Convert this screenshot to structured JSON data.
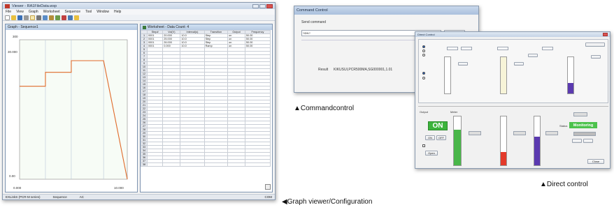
{
  "graph_app": {
    "title": "Viewer - RA1FileData.wsp",
    "menu": [
      "File",
      "View",
      "Graph",
      "Worksheet",
      "Sequence",
      "Tool",
      "Window",
      "Help"
    ],
    "graph": {
      "title": "Graph - Sequence1",
      "y_top": "300",
      "y_mid": "30.000",
      "y_bottom": "0.00",
      "x_left": "0.000",
      "x_right": "10.000",
      "chart_data": {
        "type": "line",
        "series": [
          {
            "x": [
              0,
              2.4,
              2.4,
              4.8,
              4.8,
              7.8,
              10
            ],
            "y": [
              200,
              200,
              230,
              230,
              255,
              255,
              0
            ]
          }
        ],
        "xlim": [
          0,
          10
        ],
        "ylim": [
          0,
          300
        ]
      }
    },
    "worksheet": {
      "title": "Worksheet - Data Count: 4",
      "headers": [
        "",
        "Step#",
        "Vol(V)",
        "Interval(s)",
        "Transition",
        "Output",
        "Frequency"
      ],
      "rows": [
        [
          "1",
          "0001",
          "20.000",
          "10.0",
          "Step",
          "on",
          "50.00"
        ],
        [
          "2",
          "0001",
          "25.000",
          "10.0",
          "Step",
          "on",
          "50.00"
        ],
        [
          "3",
          "0001",
          "26.000",
          "10.0",
          "Step",
          "on",
          "50.00"
        ],
        [
          "4",
          "0001",
          "0.000",
          "10.0",
          "Ramp",
          "on",
          "50.00"
        ],
        [
          "5",
          "",
          "",
          "",
          "",
          "",
          ""
        ],
        [
          "6",
          "",
          "",
          "",
          "",
          "",
          ""
        ],
        [
          "7",
          "",
          "",
          "",
          "",
          "",
          ""
        ],
        [
          "8",
          "",
          "",
          "",
          "",
          "",
          ""
        ],
        [
          "9",
          "",
          "",
          "",
          "",
          "",
          ""
        ],
        [
          "10",
          "",
          "",
          "",
          "",
          "",
          ""
        ],
        [
          "11",
          "",
          "",
          "",
          "",
          "",
          ""
        ],
        [
          "12",
          "",
          "",
          "",
          "",
          "",
          ""
        ],
        [
          "13",
          "",
          "",
          "",
          "",
          "",
          ""
        ],
        [
          "14",
          "",
          "",
          "",
          "",
          "",
          ""
        ],
        [
          "15",
          "",
          "",
          "",
          "",
          "",
          ""
        ],
        [
          "16",
          "",
          "",
          "",
          "",
          "",
          ""
        ],
        [
          "17",
          "",
          "",
          "",
          "",
          "",
          ""
        ],
        [
          "18",
          "",
          "",
          "",
          "",
          "",
          ""
        ],
        [
          "19",
          "",
          "",
          "",
          "",
          "",
          ""
        ],
        [
          "20",
          "",
          "",
          "",
          "",
          "",
          ""
        ],
        [
          "21",
          "",
          "",
          "",
          "",
          "",
          ""
        ],
        [
          "22",
          "",
          "",
          "",
          "",
          "",
          ""
        ],
        [
          "23",
          "",
          "",
          "",
          "",
          "",
          ""
        ],
        [
          "24",
          "",
          "",
          "",
          "",
          "",
          ""
        ],
        [
          "25",
          "",
          "",
          "",
          "",
          "",
          ""
        ],
        [
          "26",
          "",
          "",
          "",
          "",
          "",
          ""
        ],
        [
          "27",
          "",
          "",
          "",
          "",
          "",
          ""
        ],
        [
          "28",
          "",
          "",
          "",
          "",
          "",
          ""
        ],
        [
          "29",
          "",
          "",
          "",
          "",
          "",
          ""
        ],
        [
          "30",
          "",
          "",
          "",
          "",
          "",
          ""
        ],
        [
          "31",
          "",
          "",
          "",
          "",
          "",
          ""
        ],
        [
          "32",
          "",
          "",
          "",
          "",
          "",
          ""
        ],
        [
          "33",
          "",
          "",
          "",
          "",
          "",
          ""
        ],
        [
          "34",
          "",
          "",
          "",
          "",
          "",
          ""
        ],
        [
          "35",
          "",
          "",
          "",
          "",
          "",
          ""
        ],
        [
          "36",
          "",
          "",
          "",
          "",
          "",
          ""
        ],
        [
          "37",
          "",
          "",
          "",
          "",
          "",
          ""
        ],
        [
          "38",
          "",
          "",
          "",
          "",
          "",
          ""
        ]
      ]
    },
    "status": [
      "EXLinkS (PCR-M series)",
      "Sequence",
      "AC",
      "COM"
    ]
  },
  "command": {
    "title": "Command Control",
    "send_label": "Send command",
    "send_value": "*IDN?",
    "result_label": "Result",
    "result_value": "KIKUSUI,PCR500MA,SG000001,1.01"
  },
  "direct": {
    "title": "Direct Control",
    "output_state": "ON",
    "status_label": "Status",
    "status_value": "Monitoring",
    "output_label": "Output",
    "meter_label": "Meter",
    "on_label": "ON",
    "off_label": "OFF",
    "open_label": "Open",
    "close_label": "Close"
  },
  "captions": {
    "command": "▲Commandcontrol",
    "direct": "▲Direct control",
    "graph": "◀Graph viewer/Configuration"
  },
  "colors": {
    "graph_line": "#e06a2a",
    "on_green": "#3cb43c",
    "monitor_green": "#4cc24c",
    "bar_green": "#49b649",
    "bar_red": "#e33a2a",
    "bar_purple": "#5b3ab0",
    "bar_pale": "#f7f4d8"
  }
}
